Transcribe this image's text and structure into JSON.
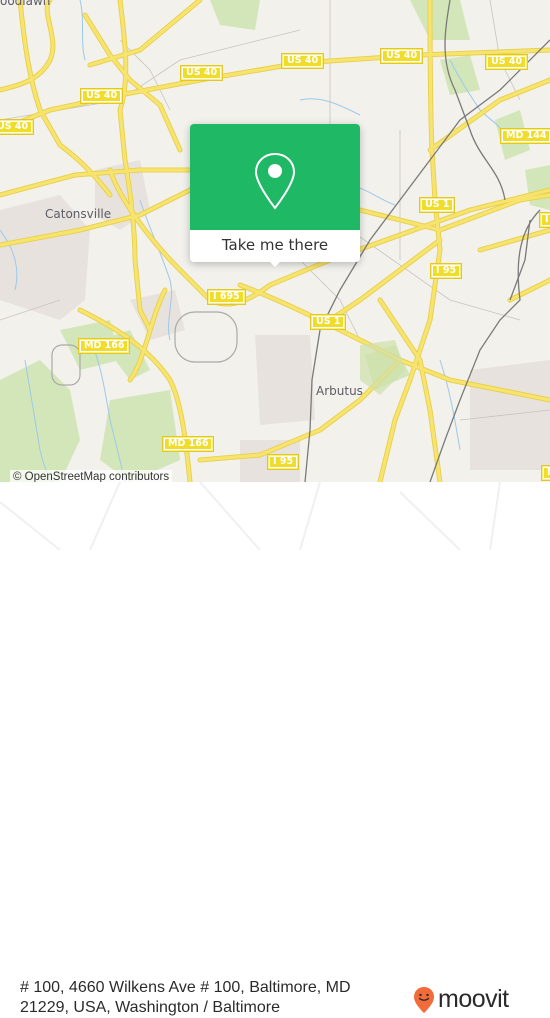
{
  "map": {
    "place_labels": [
      {
        "id": "catonsville",
        "text": "Catonsville"
      },
      {
        "id": "arbutus",
        "text": "Arbutus"
      },
      {
        "id": "woodlawn",
        "text": "oodlawn"
      }
    ],
    "road_shields": [
      {
        "id": "us40-a",
        "text": "US 40"
      },
      {
        "id": "us40-b",
        "text": "US 40"
      },
      {
        "id": "us40-c",
        "text": "US 40"
      },
      {
        "id": "us40-d",
        "text": "US 40"
      },
      {
        "id": "us40-e",
        "text": "US 40"
      },
      {
        "id": "us40-f",
        "text": "US 40"
      },
      {
        "id": "md144",
        "text": "MD 144"
      },
      {
        "id": "us1-a",
        "text": "US 1"
      },
      {
        "id": "us1-b",
        "text": "US 1"
      },
      {
        "id": "i695",
        "text": "I 695"
      },
      {
        "id": "i95-a",
        "text": "I 95"
      },
      {
        "id": "i95-b",
        "text": "I 95"
      },
      {
        "id": "md166-a",
        "text": "MD 166"
      },
      {
        "id": "md166-b",
        "text": "MD 166"
      },
      {
        "id": "partial-right-a",
        "text": "I"
      },
      {
        "id": "partial-right-b",
        "text": "M"
      }
    ],
    "attribution": "© OpenStreetMap contributors",
    "popup": {
      "button_label": "Take me there",
      "icon": "map-pin-icon",
      "accent_color": "#1fb865"
    },
    "colors": {
      "background": "#f2f1ec",
      "road": "#f6e26b",
      "road_casing": "#e8cf4a",
      "water": "#9cc9ea",
      "park": "#cfe3b4",
      "urban": "#e6e1dc",
      "rail": "#777777"
    }
  },
  "footer": {
    "address": "# 100, 4660 Wilkens Ave # 100, Baltimore, MD 21229, USA, Washington / Baltimore",
    "brand": "moovit",
    "brand_color": "#f26b3a"
  }
}
